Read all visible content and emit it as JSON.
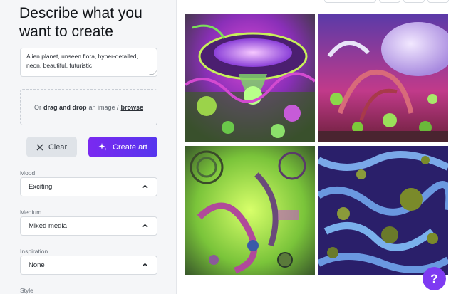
{
  "sidebar": {
    "heading": "Describe what you want to create",
    "prompt": "Alien planet, unseen flora, hyper-detailed, neon, beautiful, futuristic",
    "drop": {
      "prefix": "Or",
      "bold": "drag and drop",
      "middle": "an image /",
      "link": "browse"
    },
    "clear_label": "Clear",
    "create_label": "Create art",
    "mood": {
      "label": "Mood",
      "value": "Exciting"
    },
    "medium": {
      "label": "Medium",
      "value": "Mixed media"
    },
    "inspiration": {
      "label": "Inspiration",
      "value": "None"
    },
    "style": {
      "label": "Style"
    }
  },
  "gallery": {
    "images": [
      {
        "name": "generated-image-1",
        "theme": "purple-ufo-forest"
      },
      {
        "name": "generated-image-2",
        "theme": "mushroom-jellyfish-red"
      },
      {
        "name": "generated-image-3",
        "theme": "green-tentacle-spirals"
      },
      {
        "name": "generated-image-4",
        "theme": "blue-maze-moss-balls"
      }
    ]
  },
  "help_label": "?",
  "colors": {
    "accent": "#7a29f0",
    "accent2": "#5636ee",
    "sidebar_bg": "#f5f6f8"
  },
  "icons": [
    "close-icon",
    "sparkle-icon",
    "chevron-up-icon",
    "help-icon"
  ]
}
